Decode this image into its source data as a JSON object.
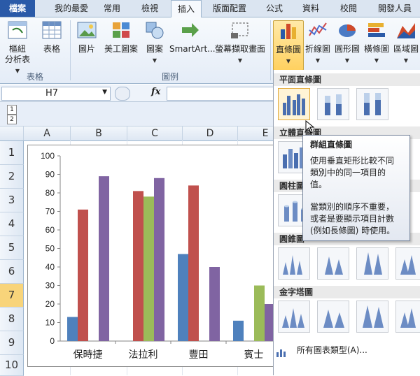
{
  "ribbon_tabs": [
    "檔案",
    "我的最愛",
    "常用",
    "檢視",
    "插入",
    "版面配置",
    "公式",
    "資料",
    "校閱",
    "開發人員"
  ],
  "ribbon": {
    "buttons": {
      "pivot": [
        "樞紐",
        "分析表"
      ],
      "table": "表格",
      "picture": "圖片",
      "clipart": "美工圖案",
      "shapes": "圖案",
      "smartart": "SmartArt...",
      "screenshot": "螢幕擷取畫面",
      "column": "直條圖",
      "line": "折線圖",
      "pie": "圓形圖",
      "bar": "橫條圖",
      "area": "區域圖"
    },
    "groups": {
      "tables": "表格",
      "illustrations": "圖例"
    }
  },
  "formula_bar": {
    "name_box": "H7",
    "fx": "fx",
    "value": ""
  },
  "sheet": {
    "columns": [
      "A",
      "B",
      "C",
      "D",
      "E"
    ],
    "rows": [
      "1",
      "2",
      "3",
      "4",
      "5",
      "6",
      "7",
      "8",
      "9",
      "10"
    ],
    "selected_row": "7",
    "outline_levels": [
      "1",
      "2"
    ]
  },
  "chart_data": {
    "type": "bar",
    "categories": [
      "保時捷",
      "法拉利",
      "豐田",
      "賓士"
    ],
    "series": [
      {
        "values": [
          13,
          0,
          47,
          11
        ],
        "color": "#4f81bd"
      },
      {
        "values": [
          71,
          81,
          84,
          null
        ],
        "color": "#c0504d"
      },
      {
        "values": [
          null,
          78,
          null,
          30
        ],
        "color": "#9bbb59"
      },
      {
        "values": [
          89,
          88,
          40,
          20
        ],
        "color": "#8064a2"
      }
    ],
    "ylim": [
      0,
      100
    ],
    "yticks": [
      0,
      10,
      20,
      30,
      40,
      50,
      60,
      70,
      80,
      90,
      100
    ],
    "grid": false,
    "legend": "none"
  },
  "gallery": {
    "sections": [
      "平面直條圖",
      "立體直條圖",
      "圓柱圖",
      "圓錐圖",
      "金字塔圖"
    ],
    "all_chart_types": "所有圖表類型(A)..."
  },
  "tooltip": {
    "title": "群組直條圖",
    "line1": "使用垂直矩形比較不同",
    "line2": "類別中的同一項目的",
    "line3": "值。",
    "line4": "當類別的順序不重要，",
    "line5": "或者是要顯示項目計數",
    "line6": "(例如長條圖) 時使用。"
  },
  "colors": {
    "accent": "#2a5aa8",
    "selected": "#ffd160"
  }
}
